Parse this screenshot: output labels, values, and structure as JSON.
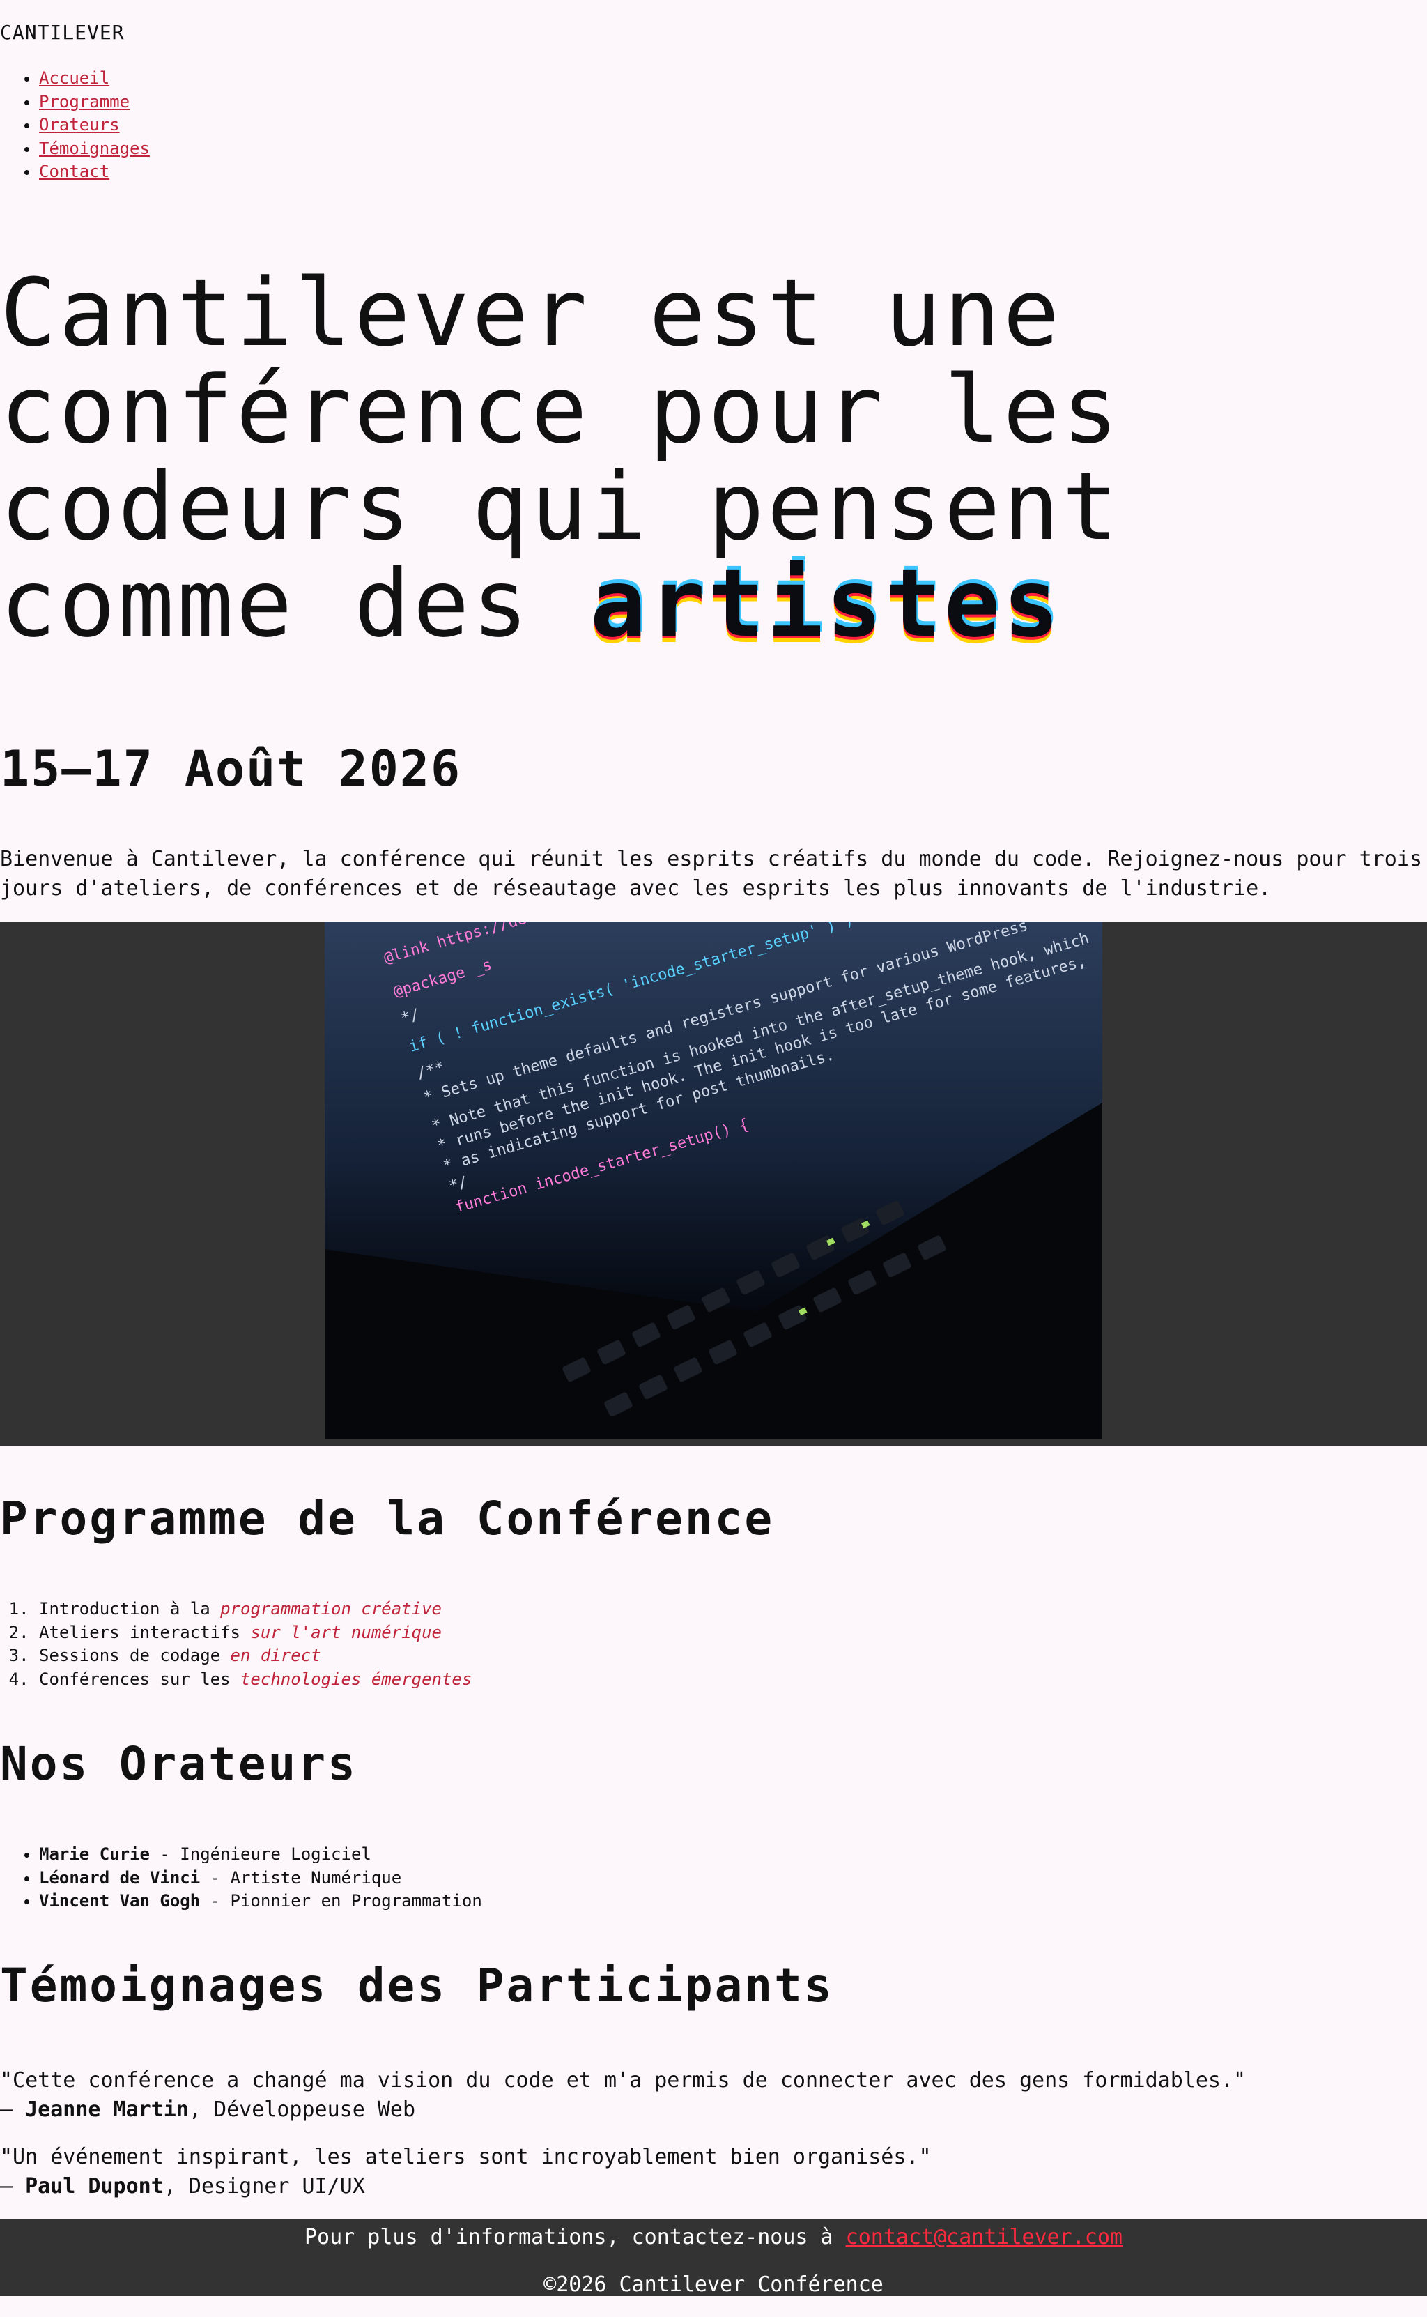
{
  "site": {
    "name": "CANTILEVER"
  },
  "nav": {
    "items": [
      {
        "label": "Accueil"
      },
      {
        "label": "Programme"
      },
      {
        "label": "Orateurs"
      },
      {
        "label": "Témoignages"
      },
      {
        "label": "Contact"
      }
    ]
  },
  "hero": {
    "line1": "Cantilever est une",
    "line2": "conférence pour les",
    "line3": "codeurs qui pensent",
    "line4_prefix": "comme des ",
    "line4_accent": "artistes"
  },
  "event": {
    "dates": "15–17 Août 2026",
    "intro": "Bienvenue à Cantilever, la conférence qui réunit les esprits créatifs du monde du code. Rejoignez-nous pour trois jours d'ateliers, de conférences et de réseautage avec les esprits les plus innovants de l'industrie."
  },
  "image": {
    "code_lines": [
      "@link https://develop",
      "@package _s",
      "*/",
      "if ( ! function_exists( 'incode_starter_setup' ) ) :",
      "/**",
      " * Sets up theme defaults and registers support for various WordPress",
      " * Note that this function is hooked into the after_setup_theme hook, which",
      " * runs before the init hook. The init hook is too late for some features,",
      " * as indicating support for post thumbnails.",
      " */",
      "function incode_starter_setup() {"
    ]
  },
  "program": {
    "title": "Programme de la Conférence",
    "items": [
      {
        "text": "Introduction à la ",
        "emphasis": "programmation créative"
      },
      {
        "text": "Ateliers interactifs ",
        "emphasis": "sur l'art numérique"
      },
      {
        "text": "Sessions de codage ",
        "emphasis": "en direct"
      },
      {
        "text": "Conférences sur les ",
        "emphasis": "technologies émergentes"
      }
    ]
  },
  "speakers": {
    "title": "Nos Orateurs",
    "items": [
      {
        "name": "Marie Curie",
        "role": " - Ingénieure Logiciel"
      },
      {
        "name": "Léonard de Vinci",
        "role": " - Artiste Numérique"
      },
      {
        "name": "Vincent Van Gogh",
        "role": " - Pionnier en Programmation"
      }
    ]
  },
  "testimonials": {
    "title": "Témoignages des Participants",
    "items": [
      {
        "quote": "\"Cette conférence a changé ma vision du code et m'a permis de connecter avec des gens formidables.\"",
        "dash": "— ",
        "author": "Jeanne Martin",
        "role": ", Développeuse Web"
      },
      {
        "quote": "\"Un événement inspirant, les ateliers sont incroyablement bien organisés.\"",
        "dash": "— ",
        "author": "Paul Dupont",
        "role": ", Designer UI/UX"
      }
    ]
  },
  "footer": {
    "contact_text": "Pour plus d'informations, contactez-nous à ",
    "contact_email": "contact@cantilever.com",
    "copyright": "©2026 Cantilever Conférence"
  },
  "colors": {
    "accent": "#c0243a",
    "background": "#fdf7fb",
    "dark": "#333333"
  }
}
